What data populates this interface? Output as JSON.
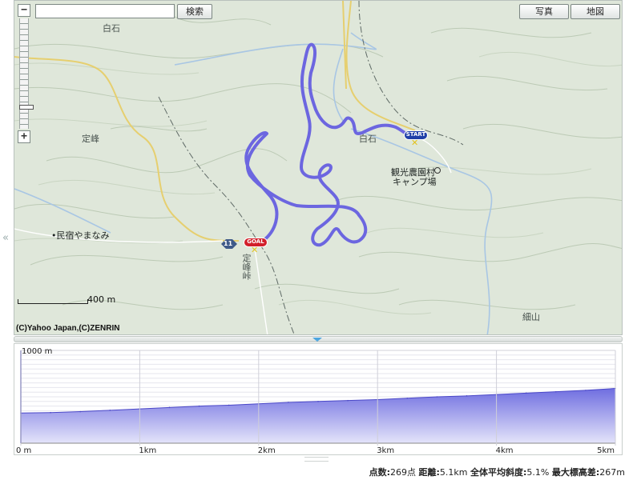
{
  "map": {
    "search": {
      "placeholder": "",
      "value": "",
      "button_label": "検索"
    },
    "map_type_buttons": {
      "photo": "写真",
      "map": "地図"
    },
    "zoom": {
      "minus": "−",
      "plus": "+"
    },
    "scale_label": "400 m",
    "copyright": "(C)Yahoo Japan,(C)ZENRIN",
    "place_labels": {
      "shiraishi_nw": "白石",
      "jomine": "定峰",
      "minshuku": "•民宿やまなみ",
      "shiraishi_e": "白石",
      "campground_line1": "観光農園村",
      "campground_line2": "キャンプ場",
      "jomine_pass": "定峰峠",
      "hosoyama": "細山",
      "route_shield": "11"
    },
    "markers": {
      "start": "START",
      "goal": "GOAL"
    },
    "colors": {
      "route": "#6c66e0",
      "land": "#dfe7da",
      "contour": "#b9c7b2",
      "road": "#e8d27a",
      "river": "#a9c8e6"
    },
    "collapse_icon": "double-chevron-left-icon"
  },
  "chart_data": {
    "type": "area",
    "ylim": [
      0,
      1000
    ],
    "xlim": [
      0,
      5
    ],
    "y_top_label": "1000 m",
    "x_ticks": [
      "0 m",
      "1km",
      "2km",
      "3km",
      "4km",
      "5km"
    ],
    "x": [
      0,
      0.25,
      0.5,
      0.75,
      1.0,
      1.25,
      1.5,
      1.75,
      2.0,
      2.25,
      2.5,
      2.75,
      3.0,
      3.25,
      3.5,
      3.75,
      4.0,
      4.25,
      4.5,
      4.75,
      5.1
    ],
    "values": [
      325,
      330,
      340,
      355,
      370,
      385,
      400,
      410,
      425,
      440,
      450,
      460,
      470,
      485,
      500,
      510,
      525,
      540,
      555,
      570,
      590
    ],
    "grid": true,
    "fill_color": "#6f6ee0"
  },
  "stats": {
    "points_label": "点数:",
    "points_value": "269点",
    "distance_label": "距離:",
    "distance_value": "5.1km",
    "grade_label": "全体平均斜度:",
    "grade_value": "5.1%",
    "elev_label": "最大標高差:",
    "elev_value": "267m"
  }
}
